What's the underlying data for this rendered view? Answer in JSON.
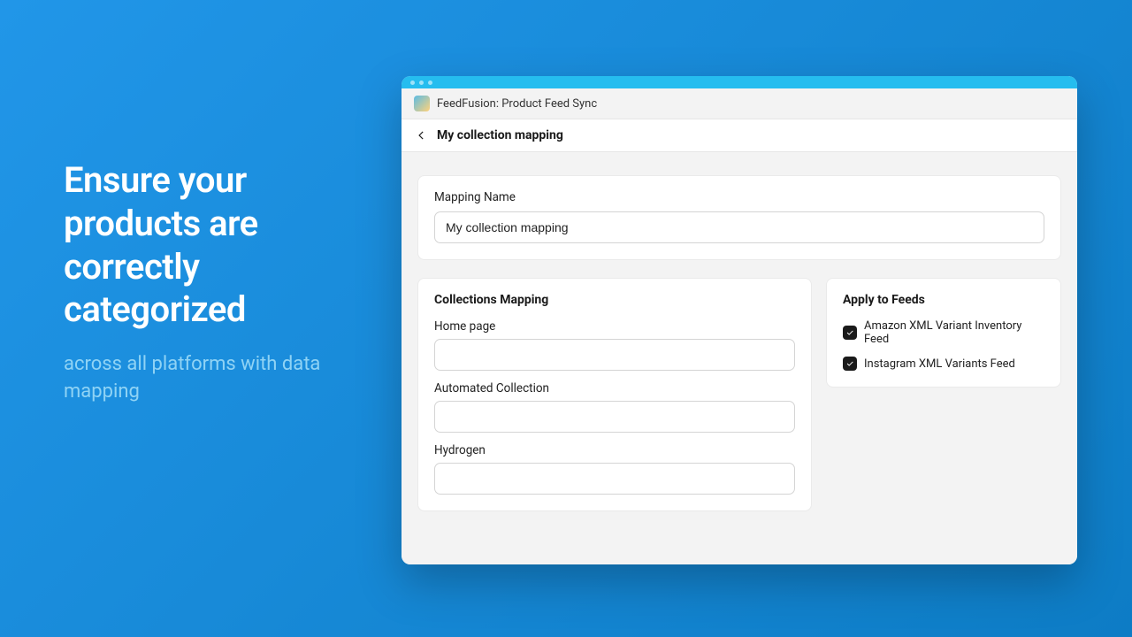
{
  "promo": {
    "headline": "Ensure your products are correctly categorized",
    "subline": "across all platforms with data mapping"
  },
  "app": {
    "title": "FeedFusion: Product Feed Sync"
  },
  "page": {
    "title": "My collection mapping"
  },
  "mapping": {
    "name_label": "Mapping Name",
    "name_value": "My collection mapping"
  },
  "collections": {
    "heading": "Collections Mapping",
    "items": [
      {
        "label": "Home page",
        "value": ""
      },
      {
        "label": "Automated Collection",
        "value": ""
      },
      {
        "label": "Hydrogen",
        "value": ""
      }
    ]
  },
  "feeds": {
    "heading": "Apply to Feeds",
    "items": [
      {
        "label": "Amazon XML Variant Inventory Feed",
        "checked": true
      },
      {
        "label": "Instagram XML Variants Feed",
        "checked": true
      }
    ]
  }
}
